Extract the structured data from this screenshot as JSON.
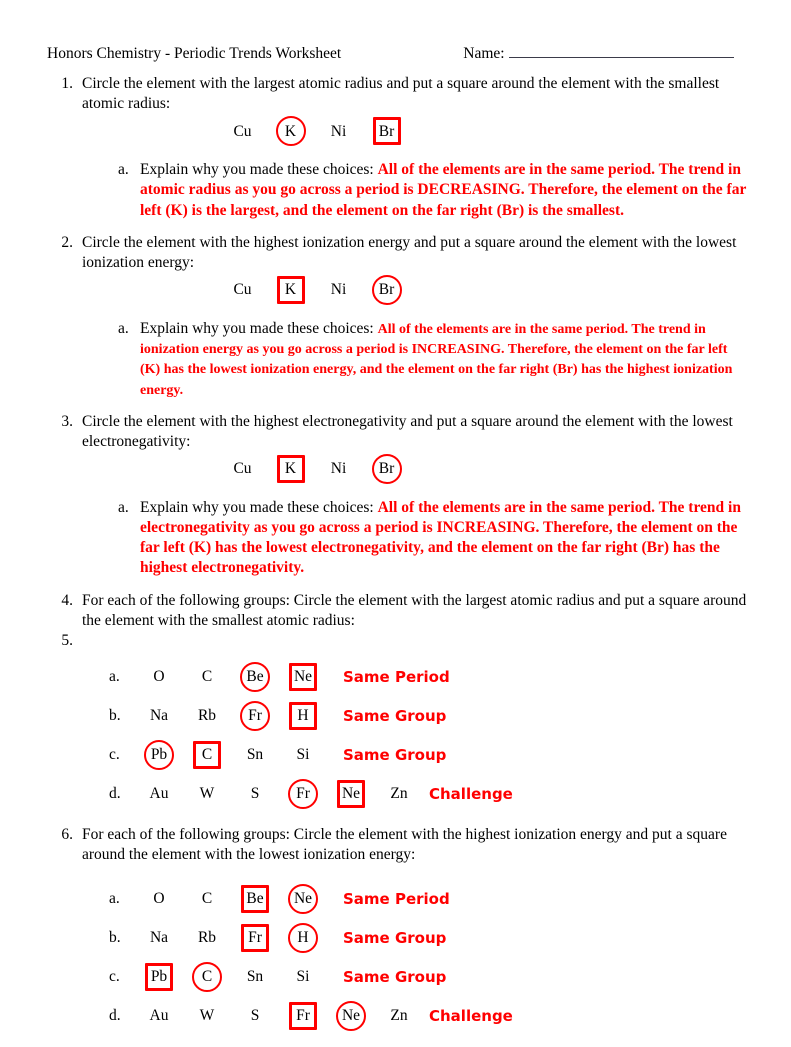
{
  "header": {
    "title": "Honors Chemistry - Periodic Trends Worksheet",
    "name_label": "Name:"
  },
  "colors": {
    "answer_red": "#ff0000",
    "body_text": "#000000",
    "name_rule": "#3b3b4a"
  },
  "questions": [
    {
      "number": "1.",
      "prompt": "Circle the element with the largest atomic radius and put a square around the element with the smallest atomic radius:",
      "elements": [
        {
          "symbol": "Cu",
          "mark": "none"
        },
        {
          "symbol": "K",
          "mark": "circle"
        },
        {
          "symbol": "Ni",
          "mark": "none"
        },
        {
          "symbol": "Br",
          "mark": "square"
        }
      ],
      "sub_mark": "a.",
      "sub_prompt": "Explain why you made these choices:",
      "answer": "All of the elements are in the same period.  The trend in atomic radius as you go across a period is DECREASING.  Therefore, the element on the far left (K) is the largest, and the element on the far right (Br) is the smallest.",
      "answer_size": "normal"
    },
    {
      "number": "2.",
      "prompt": "Circle the element with the highest ionization energy and put a square around the element with the lowest ionization energy:",
      "elements": [
        {
          "symbol": "Cu",
          "mark": "none"
        },
        {
          "symbol": "K",
          "mark": "square"
        },
        {
          "symbol": "Ni",
          "mark": "none"
        },
        {
          "symbol": "Br",
          "mark": "circle"
        }
      ],
      "sub_mark": "a.",
      "sub_prompt": "Explain why you made these choices:",
      "answer": "All of the elements are in the same period.  The trend in ionization energy as you go across a period is INCREASING.  Therefore, the element on the far left (K) has the lowest ionization energy, and the element on the far right (Br) has the highest ionization energy.",
      "answer_size": "small"
    },
    {
      "number": "3.",
      "prompt": "Circle the element with the highest electronegativity and put a square around the element with the lowest electronegativity:",
      "elements": [
        {
          "symbol": "Cu",
          "mark": "none"
        },
        {
          "symbol": "K",
          "mark": "square"
        },
        {
          "symbol": "Ni",
          "mark": "none"
        },
        {
          "symbol": "Br",
          "mark": "circle"
        }
      ],
      "sub_mark": "a.",
      "sub_prompt": "Explain why you made these choices:",
      "answer": "All of the elements are in the same period.  The trend in electronegativity as you go across a period is INCREASING.  Therefore, the element on the far left (K) has the lowest electronegativity, and the element on the far right (Br) has the highest electronegativity.",
      "answer_size": "normal"
    }
  ],
  "group_questions": [
    {
      "number": "4.",
      "prompt": "For each of the following groups: Circle the element with the largest atomic radius and put a square around the element with the smallest atomic radius:",
      "extra_number": "5.",
      "rows": [
        {
          "label": "a.",
          "cells": [
            {
              "symbol": "O",
              "mark": "none"
            },
            {
              "symbol": "C",
              "mark": "none"
            },
            {
              "symbol": "Be",
              "mark": "circle"
            },
            {
              "symbol": "Ne",
              "mark": "square"
            }
          ],
          "tag": "Same Period",
          "tag_tight": false
        },
        {
          "label": "b.",
          "cells": [
            {
              "symbol": "Na",
              "mark": "none"
            },
            {
              "symbol": "Rb",
              "mark": "none"
            },
            {
              "symbol": "Fr",
              "mark": "circle"
            },
            {
              "symbol": "H",
              "mark": "square"
            }
          ],
          "tag": "Same Group",
          "tag_tight": false
        },
        {
          "label": "c.",
          "cells": [
            {
              "symbol": "Pb",
              "mark": "circle"
            },
            {
              "symbol": "C",
              "mark": "square"
            },
            {
              "symbol": "Sn",
              "mark": "none"
            },
            {
              "symbol": "Si",
              "mark": "none"
            }
          ],
          "tag": "Same Group",
          "tag_tight": false
        },
        {
          "label": "d.",
          "cells": [
            {
              "symbol": "Au",
              "mark": "none"
            },
            {
              "symbol": "W",
              "mark": "none"
            },
            {
              "symbol": "S",
              "mark": "none"
            },
            {
              "symbol": "Fr",
              "mark": "circle"
            },
            {
              "symbol": "Ne",
              "mark": "square"
            },
            {
              "symbol": "Zn",
              "mark": "none"
            }
          ],
          "tag": "Challenge",
          "tag_tight": true
        }
      ]
    },
    {
      "number": "6.",
      "prompt": "For each of the following groups: Circle the element with the highest ionization energy and put a square around the element with the lowest ionization energy:",
      "extra_number": "",
      "rows": [
        {
          "label": "a.",
          "cells": [
            {
              "symbol": "O",
              "mark": "none"
            },
            {
              "symbol": "C",
              "mark": "none"
            },
            {
              "symbol": "Be",
              "mark": "square"
            },
            {
              "symbol": "Ne",
              "mark": "circle"
            }
          ],
          "tag": "Same Period",
          "tag_tight": false
        },
        {
          "label": "b.",
          "cells": [
            {
              "symbol": "Na",
              "mark": "none"
            },
            {
              "symbol": "Rb",
              "mark": "none"
            },
            {
              "symbol": "Fr",
              "mark": "square"
            },
            {
              "symbol": "H",
              "mark": "circle"
            }
          ],
          "tag": "Same Group",
          "tag_tight": false
        },
        {
          "label": "c.",
          "cells": [
            {
              "symbol": "Pb",
              "mark": "square"
            },
            {
              "symbol": "C",
              "mark": "circle"
            },
            {
              "symbol": "Sn",
              "mark": "none"
            },
            {
              "symbol": "Si",
              "mark": "none"
            }
          ],
          "tag": "Same Group",
          "tag_tight": false
        },
        {
          "label": "d.",
          "cells": [
            {
              "symbol": "Au",
              "mark": "none"
            },
            {
              "symbol": "W",
              "mark": "none"
            },
            {
              "symbol": "S",
              "mark": "none"
            },
            {
              "symbol": "Fr",
              "mark": "square"
            },
            {
              "symbol": "Ne",
              "mark": "circle"
            },
            {
              "symbol": "Zn",
              "mark": "none"
            }
          ],
          "tag": "Challenge",
          "tag_tight": true
        }
      ]
    }
  ]
}
